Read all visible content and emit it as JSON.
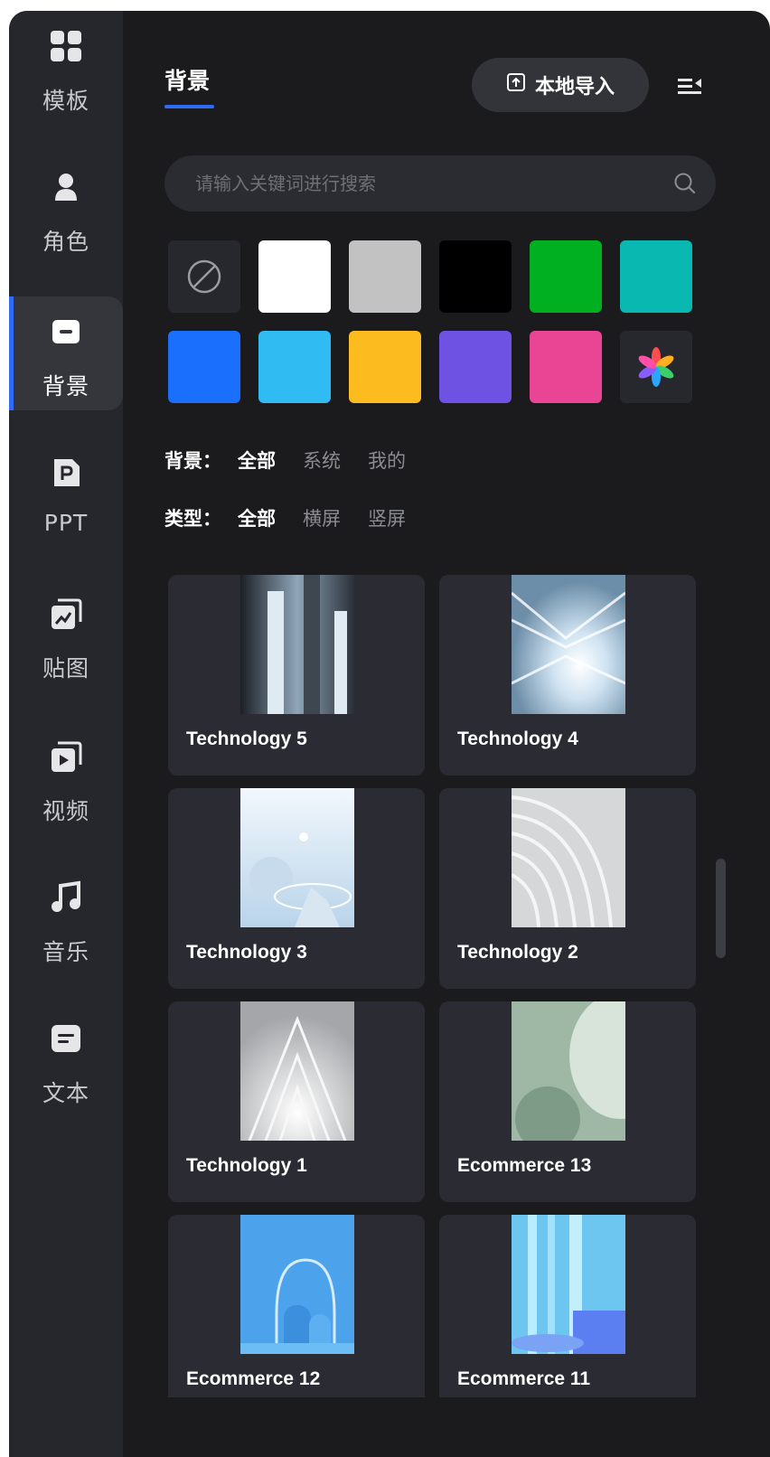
{
  "sidebar": {
    "items": [
      {
        "label": "模板",
        "icon": "template-grid-icon"
      },
      {
        "label": "角色",
        "icon": "person-icon"
      },
      {
        "label": "背景",
        "icon": "background-icon"
      },
      {
        "label": "PPT",
        "icon": "ppt-icon"
      },
      {
        "label": "贴图",
        "icon": "sticker-icon"
      },
      {
        "label": "视频",
        "icon": "video-icon"
      },
      {
        "label": "音乐",
        "icon": "music-note-icon"
      },
      {
        "label": "文本",
        "icon": "text-icon"
      }
    ],
    "active_item": "背景",
    "accent_color": "#2f6cf6"
  },
  "header": {
    "tab_title": "背景",
    "import_button": "本地导入"
  },
  "search": {
    "placeholder": "请输入关键词进行搜索"
  },
  "swatches": [
    {
      "name": "none",
      "color": ""
    },
    {
      "name": "white",
      "color": "#ffffff"
    },
    {
      "name": "gray",
      "color": "#c2c2c2"
    },
    {
      "name": "black",
      "color": "#000000"
    },
    {
      "name": "green",
      "color": "#00b020"
    },
    {
      "name": "teal",
      "color": "#0ab8b2"
    },
    {
      "name": "blue",
      "color": "#1a6ffd"
    },
    {
      "name": "sky-blue",
      "color": "#30bbf2"
    },
    {
      "name": "yellow",
      "color": "#fcbc20"
    },
    {
      "name": "purple",
      "color": "#6d52e4"
    },
    {
      "name": "pink",
      "color": "#ea4494"
    },
    {
      "name": "custom-color-picker",
      "color": ""
    }
  ],
  "filters": {
    "background": {
      "label": "背景：",
      "options": [
        "全部",
        "系统",
        "我的"
      ],
      "selected": "全部"
    },
    "type": {
      "label": "类型：",
      "options": [
        "全部",
        "横屏",
        "竖屏"
      ],
      "selected": "全部"
    }
  },
  "cards": [
    {
      "label": "Technology 5"
    },
    {
      "label": "Technology 4"
    },
    {
      "label": "Technology 3"
    },
    {
      "label": "Technology 2"
    },
    {
      "label": "Technology 1"
    },
    {
      "label": "Ecommerce 13"
    },
    {
      "label": "Ecommerce 12"
    },
    {
      "label": "Ecommerce 11"
    }
  ]
}
